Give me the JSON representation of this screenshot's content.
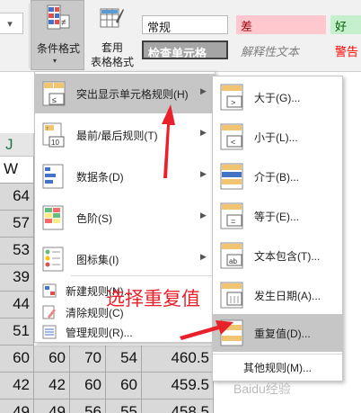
{
  "ribbon": {
    "conditional_format_label": "条件格式",
    "table_format_label_1": "套用",
    "table_format_label_2": "表格格式",
    "styles": {
      "normal": "常规",
      "bad": "差",
      "good": "好",
      "check": "检查单元格",
      "explain": "解释性文本",
      "warn": "警告"
    }
  },
  "sheet": {
    "col_letter": "J",
    "header_partial": "W",
    "col_a": [
      "64",
      "57",
      "53",
      "39",
      "44",
      "51",
      "60",
      "42",
      "49"
    ],
    "rows_full": [
      [
        "60",
        "70",
        "54",
        "460.5"
      ],
      [
        "42",
        "60",
        "60",
        "459.5"
      ],
      [
        "49",
        "56",
        "55",
        "458.5"
      ]
    ]
  },
  "menu": {
    "items": [
      {
        "label": "突出显示单元格规则(H)",
        "icon": "highlight-rules-icon",
        "submenu": true
      },
      {
        "label": "最前/最后规则(T)",
        "icon": "top-bottom-rules-icon",
        "submenu": true
      },
      {
        "label": "数据条(D)",
        "icon": "data-bars-icon",
        "submenu": true
      },
      {
        "label": "色阶(S)",
        "icon": "color-scales-icon",
        "submenu": true
      },
      {
        "label": "图标集(I)",
        "icon": "icon-sets-icon",
        "submenu": true
      }
    ],
    "small_items": [
      {
        "label": "新建规则(N)...",
        "icon": "new-rule-icon"
      },
      {
        "label": "清除规则(C)",
        "icon": "clear-rules-icon"
      },
      {
        "label": "管理规则(R)...",
        "icon": "manage-rules-icon"
      }
    ]
  },
  "submenu": {
    "items": [
      {
        "label": "大于(G)...",
        "symbol": ">"
      },
      {
        "label": "小于(L)...",
        "symbol": "<"
      },
      {
        "label": "介于(B)...",
        "symbol": ""
      },
      {
        "label": "等于(E)...",
        "symbol": "="
      },
      {
        "label": "文本包含(T)...",
        "symbol": "ab"
      },
      {
        "label": "发生日期(A)...",
        "symbol": ""
      },
      {
        "label": "重复值(D)...",
        "symbol": ""
      }
    ],
    "more": "其他规则(M)..."
  },
  "annotation": "选择重复值",
  "watermark": "Baidu经验",
  "colors": {
    "highlight": "#c6c6c6",
    "annotation_red": "#e8212a",
    "cell_fill": "#d9d9d9"
  }
}
